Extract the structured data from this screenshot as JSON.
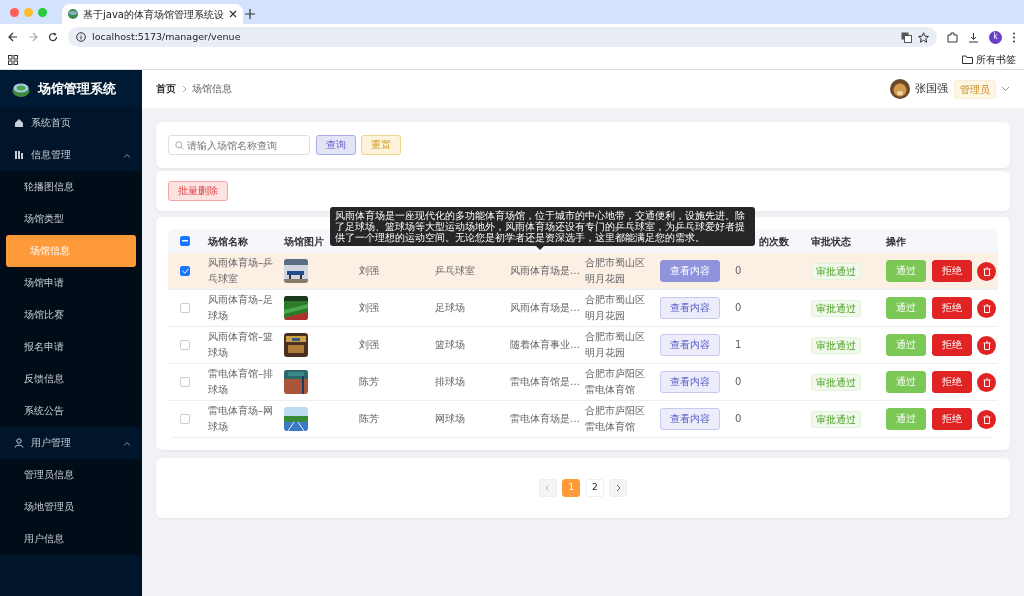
{
  "browser": {
    "tab_title": "基于java的体育场馆管理系统设",
    "url": "localhost:5173/manager/venue",
    "profile_initial": "k",
    "bookmarks_label": "所有书签"
  },
  "sidebar": {
    "app_title": "场馆管理系统",
    "items": [
      {
        "kind": "link",
        "label": "系统首页",
        "selected": false
      },
      {
        "kind": "group",
        "label": "信息管理",
        "expanded": true,
        "children": [
          {
            "kind": "link",
            "label": "轮播图信息",
            "selected": false
          },
          {
            "kind": "link",
            "label": "场馆类型",
            "selected": false
          },
          {
            "kind": "link",
            "label": "场馆信息",
            "selected": true
          },
          {
            "kind": "link",
            "label": "场馆申请",
            "selected": false
          },
          {
            "kind": "link",
            "label": "场馆比赛",
            "selected": false
          },
          {
            "kind": "link",
            "label": "报名申请",
            "selected": false
          },
          {
            "kind": "link",
            "label": "反馈信息",
            "selected": false
          },
          {
            "kind": "link",
            "label": "系统公告",
            "selected": false
          }
        ]
      },
      {
        "kind": "group",
        "label": "用户管理",
        "expanded": true,
        "children": [
          {
            "kind": "link",
            "label": "管理员信息",
            "selected": false
          },
          {
            "kind": "link",
            "label": "场地管理员",
            "selected": false
          },
          {
            "kind": "link",
            "label": "用户信息",
            "selected": false
          }
        ]
      }
    ]
  },
  "breadcrumb": [
    "首页",
    "场馆信息"
  ],
  "user": {
    "name": "张国强",
    "role": "管理员"
  },
  "search": {
    "placeholder": "请输入场馆名称查询",
    "query_button": "查询",
    "reset_button": "重置"
  },
  "batch_delete_button": "批量删除",
  "table": {
    "header_checkbox": {
      "indeterminate": true
    },
    "headers": {
      "name": "场馆名称",
      "image": "场馆图片",
      "count": "的次数",
      "status": "审批状态",
      "actions": "操作"
    },
    "rows": [
      {
        "selected": true,
        "hovered": true,
        "name": "风雨体育场–乒乓球室",
        "manager": "刘强",
        "type": "乒乓球室",
        "description": "风雨体育场是…",
        "address": "合肥市蜀山区明月花园",
        "view_button": "查看内容",
        "view_active": true,
        "count": "0",
        "status": "审批通过",
        "approve_button": "通过",
        "reject_button": "拒绝"
      },
      {
        "selected": false,
        "hovered": false,
        "name": "风雨体育场–足球场",
        "manager": "刘强",
        "type": "足球场",
        "description": "风雨体育场是…",
        "address": "合肥市蜀山区明月花园",
        "view_button": "查看内容",
        "view_active": false,
        "count": "0",
        "status": "审批通过",
        "approve_button": "通过",
        "reject_button": "拒绝"
      },
      {
        "selected": false,
        "hovered": false,
        "name": "风雨体育馆–篮球场",
        "manager": "刘强",
        "type": "篮球场",
        "description": "随着体育事业…",
        "address": "合肥市蜀山区明月花园",
        "view_button": "查看内容",
        "view_active": false,
        "count": "1",
        "status": "审批通过",
        "approve_button": "通过",
        "reject_button": "拒绝"
      },
      {
        "selected": false,
        "hovered": false,
        "name": "雷电体育馆–排球场",
        "manager": "陈芳",
        "type": "排球场",
        "description": "雷电体育馆是…",
        "address": "合肥市庐阳区雷电体育馆",
        "view_button": "查看内容",
        "view_active": false,
        "count": "0",
        "status": "审批通过",
        "approve_button": "通过",
        "reject_button": "拒绝"
      },
      {
        "selected": false,
        "hovered": false,
        "name": "雷电体育场–网球场",
        "manager": "陈芳",
        "type": "网球场",
        "description": "雷电体育场是…",
        "address": "合肥市庐阳区雷电体育馆",
        "view_button": "查看内容",
        "view_active": false,
        "count": "0",
        "status": "审批通过",
        "approve_button": "通过",
        "reject_button": "拒绝"
      }
    ]
  },
  "tooltip": "风雨体育场是一座现代化的多功能体育场馆，位于城市的中心地带，交通便利，设施先进。除了足球场、篮球场等大型运动场地外，风雨体育场还设有专门的乒乓球室，为乒乓球爱好者提供了一个理想的运动空间。无论您是初学者还是资深选手，这里都能满足您的需求。",
  "pagination": {
    "pages": [
      {
        "label": "1",
        "selected": true
      },
      {
        "label": "2",
        "selected": false
      }
    ]
  }
}
